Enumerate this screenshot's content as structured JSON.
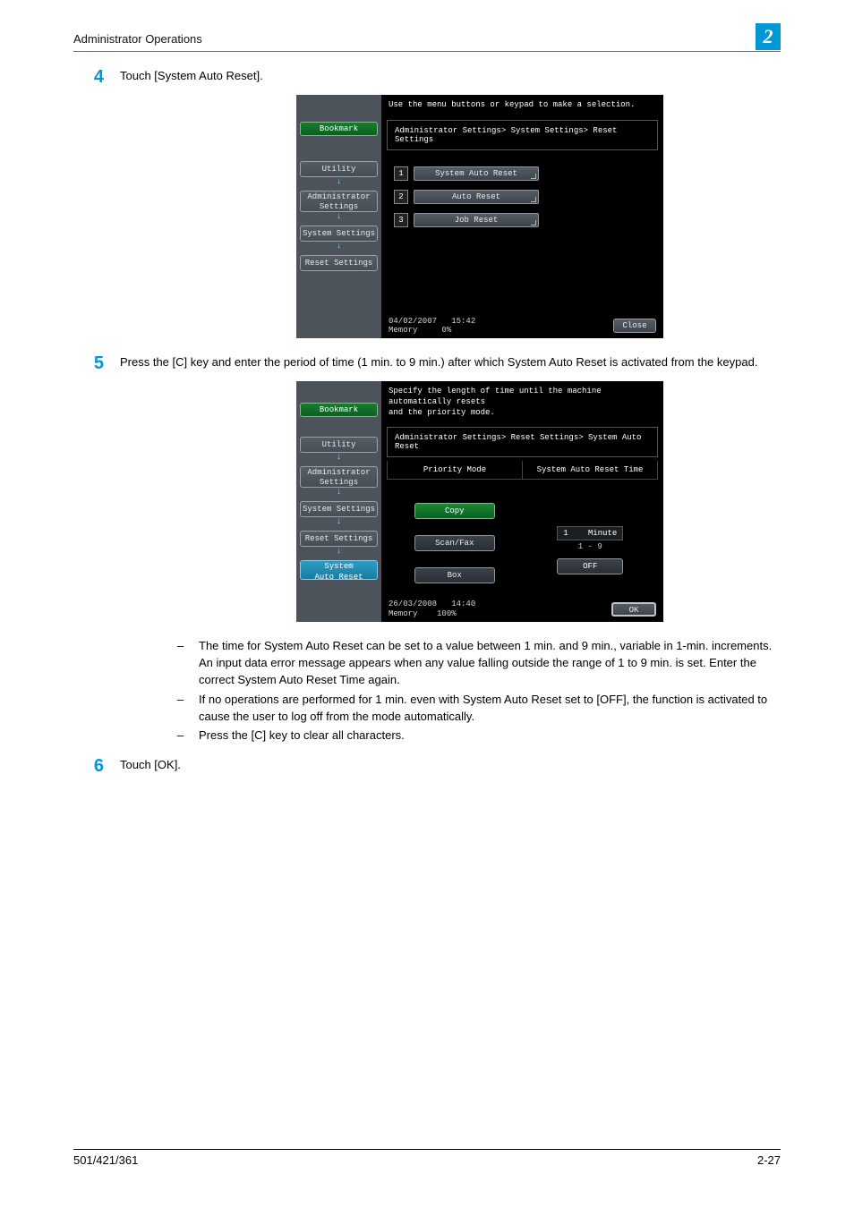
{
  "header": {
    "title": "Administrator Operations",
    "chapter_num": "2"
  },
  "steps": [
    {
      "num": "4",
      "text": "Touch [System Auto Reset]."
    },
    {
      "num": "5",
      "text": "Press the [C] key and enter the period of time (1 min. to 9 min.) after which System Auto Reset is activated from the keypad."
    },
    {
      "num": "6",
      "text": "Touch [OK]."
    }
  ],
  "dev1": {
    "top_msg": "Use the menu buttons or keypad to make a selection.",
    "bookmark": "Bookmark",
    "crumb": "Administrator Settings> System Settings> Reset Settings",
    "side": {
      "utility": "Utility",
      "admin": "Administrator\nSettings",
      "sys": "System Settings",
      "reset": "Reset Settings"
    },
    "menu": [
      {
        "num": "1",
        "label": "System Auto Reset"
      },
      {
        "num": "2",
        "label": "Auto Reset"
      },
      {
        "num": "3",
        "label": "Job Reset"
      }
    ],
    "footer": {
      "date": "04/02/2007",
      "time": "15:42",
      "mem_label": "Memory",
      "mem_val": "0%",
      "close": "Close"
    }
  },
  "dev2": {
    "top_msg": "Specify the length of time until the machine automatically resets\nand the priority mode.",
    "bookmark": "Bookmark",
    "crumb": "Administrator Settings> Reset Settings> System Auto Reset",
    "cols": {
      "left": "Priority Mode",
      "right": "System Auto Reset Time"
    },
    "side": {
      "utility": "Utility",
      "admin": "Administrator\nSettings",
      "sys": "System Settings",
      "reset": "Reset Settings",
      "auto": "System\nAuto Reset"
    },
    "left_btns": {
      "copy": "Copy",
      "scanfax": "Scan/Fax",
      "box": "Box"
    },
    "right_panel": {
      "value": "1",
      "unit": "Minute",
      "range": "1 - 9",
      "off": "OFF"
    },
    "footer": {
      "date": "26/03/2008",
      "time": "14:40",
      "mem_label": "Memory",
      "mem_val": "100%",
      "ok": "OK"
    }
  },
  "bullets": [
    "The time for System Auto Reset can be set to a value between 1 min. and 9 min., variable in 1-min. increments. An input data error message appears when any value falling outside the range of 1 to 9 min. is set. Enter the correct System Auto Reset Time again.",
    "If no operations are performed for 1 min. even with System Auto Reset set to [OFF], the function is activated to cause the user to log off from the mode automatically.",
    "Press the [C] key to clear all characters."
  ],
  "footer": {
    "left": "501/421/361",
    "right": "2-27"
  }
}
